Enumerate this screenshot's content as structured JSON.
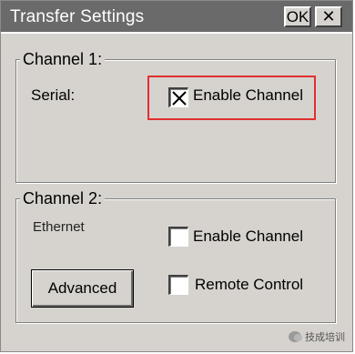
{
  "window": {
    "title": "Transfer Settings",
    "ok_label": "OK",
    "close_glyph": "✕"
  },
  "channel1": {
    "legend": "Channel 1:",
    "type_label": "Serial:",
    "enable": {
      "label": "Enable Channel",
      "checked": true
    }
  },
  "channel2": {
    "legend": "Channel 2:",
    "type_label": "Ethernet",
    "enable": {
      "label": "Enable Channel",
      "checked": false
    },
    "remote": {
      "label": "Remote Control",
      "checked": false
    },
    "advanced_label": "Advanced"
  },
  "watermark": {
    "text": "技成培训",
    "icon": "wechat-icon"
  },
  "colors": {
    "dialog_bg": "#d6d3ce",
    "titlebar": "#6a6a6a",
    "highlight": "#e03030"
  }
}
